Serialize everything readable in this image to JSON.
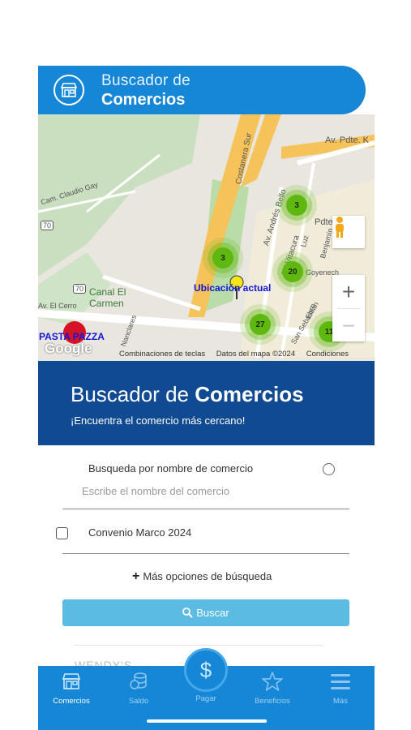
{
  "header": {
    "title_line1": "Buscador de",
    "title_line2": "Comercios",
    "icon": "store-icon"
  },
  "map": {
    "street_labels": [
      "Av. Pdte. K",
      "Costanera Sur",
      "Av. Andrés Bello",
      "Av. Vitacura",
      "Pdte",
      "Luz",
      "Benjamín",
      "Goyenech",
      "Cam. Claudio Gay",
      "Av. El Cerro",
      "Ebro",
      "San Sebastián",
      "Nanclares"
    ],
    "route_badges": [
      "70",
      "70"
    ],
    "place_label": "Canal El Carmen",
    "clusters": [
      "3",
      "3",
      "20",
      "27",
      "11"
    ],
    "current_location_label": "Ubicación actual",
    "marker_label": "PASTA PAZZA",
    "google_logo": "Google",
    "footer": [
      "Combinaciones de teclas",
      "Datos del mapa ©2024",
      "Condiciones"
    ],
    "zoom_in": "+",
    "zoom_out": "−"
  },
  "banner": {
    "title_prefix": "Buscador de ",
    "title_bold": "Comercios",
    "subtitle": "¡Encuentra el comercio más cercano!"
  },
  "form": {
    "search_by_name_label": "Busqueda por nombre de comercio",
    "name_placeholder": "Escribe el nombre del comercio",
    "agreement_label": "Convenio Marco 2024",
    "more_options_label": "Más opciones de búsqueda",
    "search_button": "Buscar",
    "faded_result": "WENDY'S"
  },
  "nav": {
    "items": [
      {
        "label": "Comercios",
        "icon": "store-icon"
      },
      {
        "label": "Saldo",
        "icon": "coins-icon"
      },
      {
        "label": "Pagar",
        "icon": "dollar-icon"
      },
      {
        "label": "Beneficios",
        "icon": "star-icon"
      },
      {
        "label": "Más",
        "icon": "menu-icon"
      }
    ]
  },
  "colors": {
    "primary": "#1687d6",
    "banner": "#0f4a92",
    "button": "#5bbbe2",
    "cluster": "#5fb80f"
  }
}
